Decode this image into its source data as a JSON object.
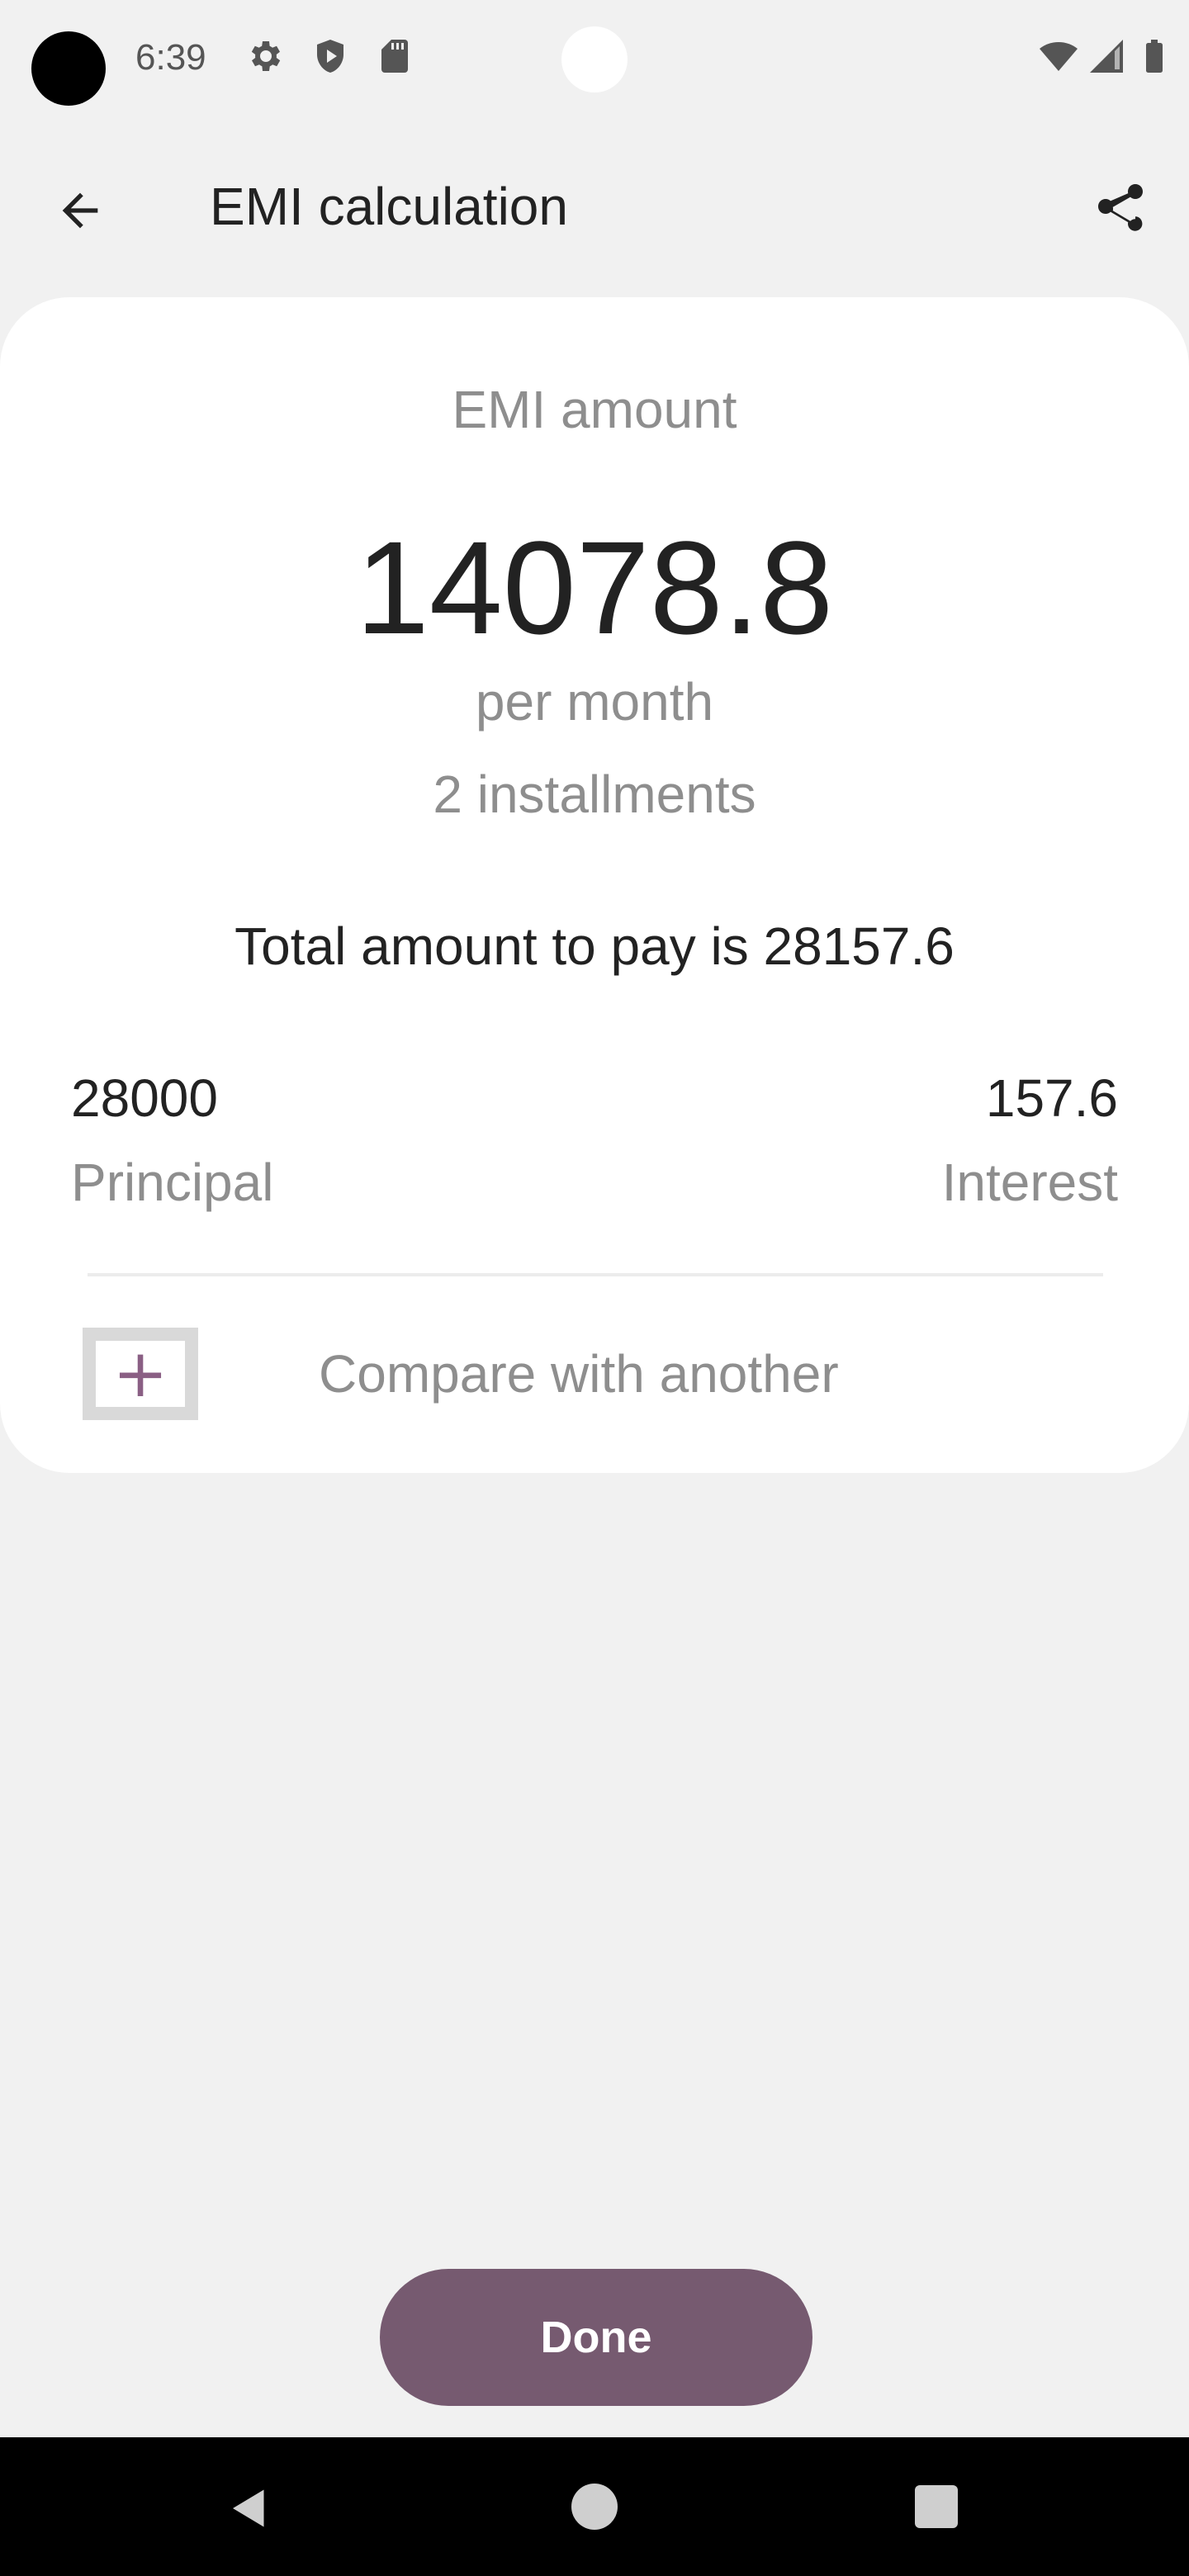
{
  "status_bar": {
    "time": "6:39",
    "icons": [
      "settings-icon",
      "shield-play-icon",
      "sd-card-icon",
      "wifi-icon",
      "signal-icon",
      "battery-icon"
    ]
  },
  "app_bar": {
    "title": "EMI calculation",
    "back_icon": "arrow-back-icon",
    "share_icon": "share-icon"
  },
  "result": {
    "emi_label": "EMI amount",
    "emi_amount": "14078.8",
    "per_month": "per month",
    "installments": "2 installments",
    "total_text": "Total amount to pay is 28157.6",
    "principal_value": "28000",
    "principal_label": "Principal",
    "interest_value": "157.6",
    "interest_label": "Interest",
    "compare_label": "Compare with another",
    "compare_icon": "plus-icon"
  },
  "actions": {
    "done_label": "Done"
  },
  "nav_bar": {
    "icons": [
      "nav-back-icon",
      "nav-home-icon",
      "nav-recents-icon"
    ]
  },
  "colors": {
    "background": "#f1f1f1",
    "card": "#ffffff",
    "accent": "#765a70",
    "plus": "#8a5f84",
    "secondary_text": "#8e8e8e",
    "primary_text": "#222222"
  }
}
